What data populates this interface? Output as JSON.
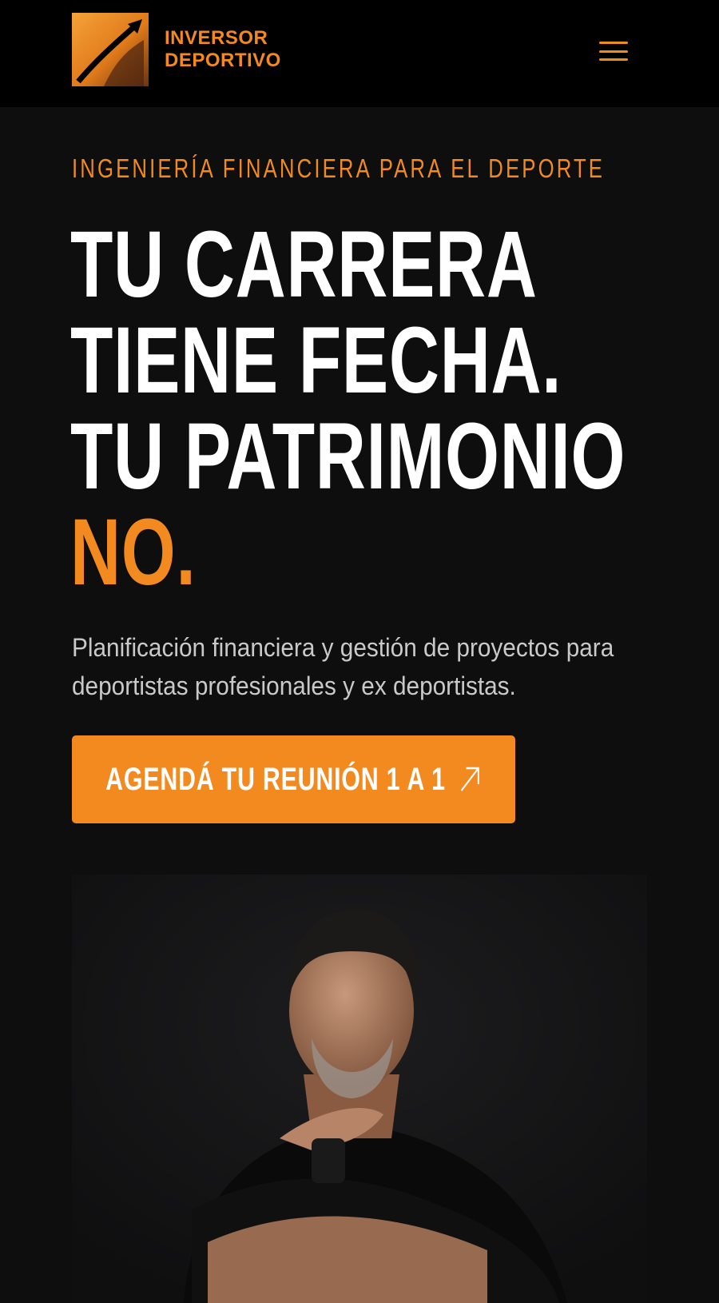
{
  "header": {
    "logo_line1": "INVERSOR",
    "logo_line2": "DEPORTIVO",
    "menu_icon": "hamburger-menu-icon"
  },
  "hero": {
    "eyebrow": "INGENIERÍA FINANCIERA PARA EL DEPORTE",
    "headline_line1": "TU CARRERA",
    "headline_line2": "TIENE FECHA.",
    "headline_line3": "TU PATRIMONIO",
    "headline_accent": "NO.",
    "subtitle": "Planificación financiera y gestión de proyectos para deportistas profesionales y ex deportistas.",
    "cta_label": "AGENDÁ TU REUNIÓN 1 A 1",
    "cta_icon": "arrow-up-right-icon"
  },
  "colors": {
    "accent": "#f28a1f",
    "background": "#0e0e0f",
    "header_bg": "#000000",
    "headline": "#ffffff"
  }
}
